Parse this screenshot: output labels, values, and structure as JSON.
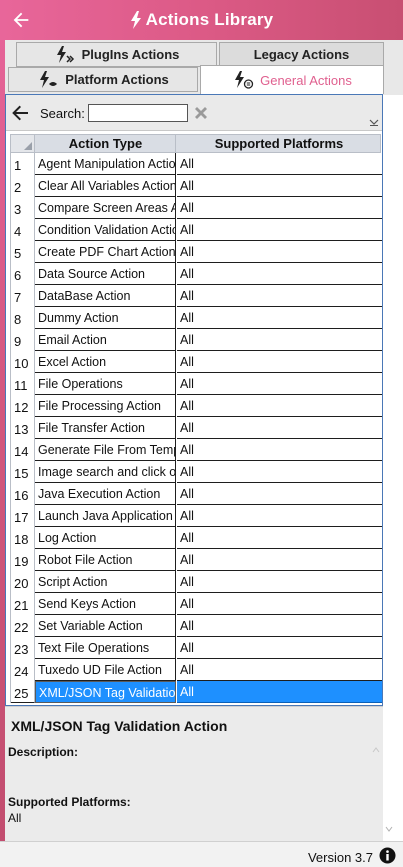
{
  "header": {
    "title": "Actions Library",
    "back_icon": "back-arrow-icon",
    "title_icon": "lightning-bolt-icon"
  },
  "tabs": {
    "row1": [
      {
        "label": "PlugIns Actions",
        "icon": "plugin-lightning-icon"
      },
      {
        "label": "Legacy Actions",
        "icon": ""
      }
    ],
    "row2": [
      {
        "label": "Platform Actions",
        "icon": "platform-lightning-icon"
      },
      {
        "label": "General Actions",
        "icon": "general-lightning-icon",
        "selected": true
      }
    ]
  },
  "search": {
    "label": "Search:",
    "value": "",
    "placeholder": ""
  },
  "grid": {
    "columns": [
      "Action Type",
      "Supported Platforms"
    ],
    "rows": [
      {
        "num": "1",
        "type": "Agent Manipulation Action",
        "platforms": "All"
      },
      {
        "num": "2",
        "type": "Clear All Variables Action",
        "platforms": "All"
      },
      {
        "num": "3",
        "type": "Compare Screen Areas Action",
        "platforms": "All"
      },
      {
        "num": "4",
        "type": "Condition Validation Action",
        "platforms": "All"
      },
      {
        "num": "5",
        "type": "Create PDF Chart Action",
        "platforms": "All"
      },
      {
        "num": "6",
        "type": "Data Source Action",
        "platforms": "All"
      },
      {
        "num": "7",
        "type": "DataBase Action",
        "platforms": "All"
      },
      {
        "num": "8",
        "type": "Dummy Action",
        "platforms": "All"
      },
      {
        "num": "9",
        "type": "Email Action",
        "platforms": "All"
      },
      {
        "num": "10",
        "type": "Excel Action",
        "platforms": "All"
      },
      {
        "num": "11",
        "type": "File Operations",
        "platforms": "All"
      },
      {
        "num": "12",
        "type": "File Processing Action",
        "platforms": "All"
      },
      {
        "num": "13",
        "type": "File Transfer Action",
        "platforms": "All"
      },
      {
        "num": "14",
        "type": "Generate File From Template",
        "platforms": "All"
      },
      {
        "num": "15",
        "type": "Image search and click or",
        "platforms": "All"
      },
      {
        "num": "16",
        "type": "Java Execution Action",
        "platforms": "All"
      },
      {
        "num": "17",
        "type": "Launch Java Application",
        "platforms": "All"
      },
      {
        "num": "18",
        "type": "Log Action",
        "platforms": "All"
      },
      {
        "num": "19",
        "type": "Robot File Action",
        "platforms": "All"
      },
      {
        "num": "20",
        "type": "Script Action",
        "platforms": "All"
      },
      {
        "num": "21",
        "type": "Send Keys Action",
        "platforms": "All"
      },
      {
        "num": "22",
        "type": "Set Variable Action",
        "platforms": "All"
      },
      {
        "num": "23",
        "type": "Text File Operations",
        "platforms": "All"
      },
      {
        "num": "24",
        "type": "Tuxedo UD File Action",
        "platforms": "All"
      },
      {
        "num": "25",
        "type": "XML/JSON Tag Validation",
        "platforms": "All",
        "selected": true
      }
    ]
  },
  "details": {
    "title": "XML/JSON Tag Validation Action",
    "description_label": "Description:",
    "description": "",
    "platforms_label": "Supported Platforms:",
    "platforms_value": "All"
  },
  "status": {
    "version": "Version 3.7",
    "info_icon": "info-icon"
  },
  "colors": {
    "header_start": "#e8669a",
    "header_end": "#c84f72",
    "selected_row": "#1e90ff",
    "selected_tab_text": "#e0608f",
    "panel_border": "#4a78b7"
  }
}
